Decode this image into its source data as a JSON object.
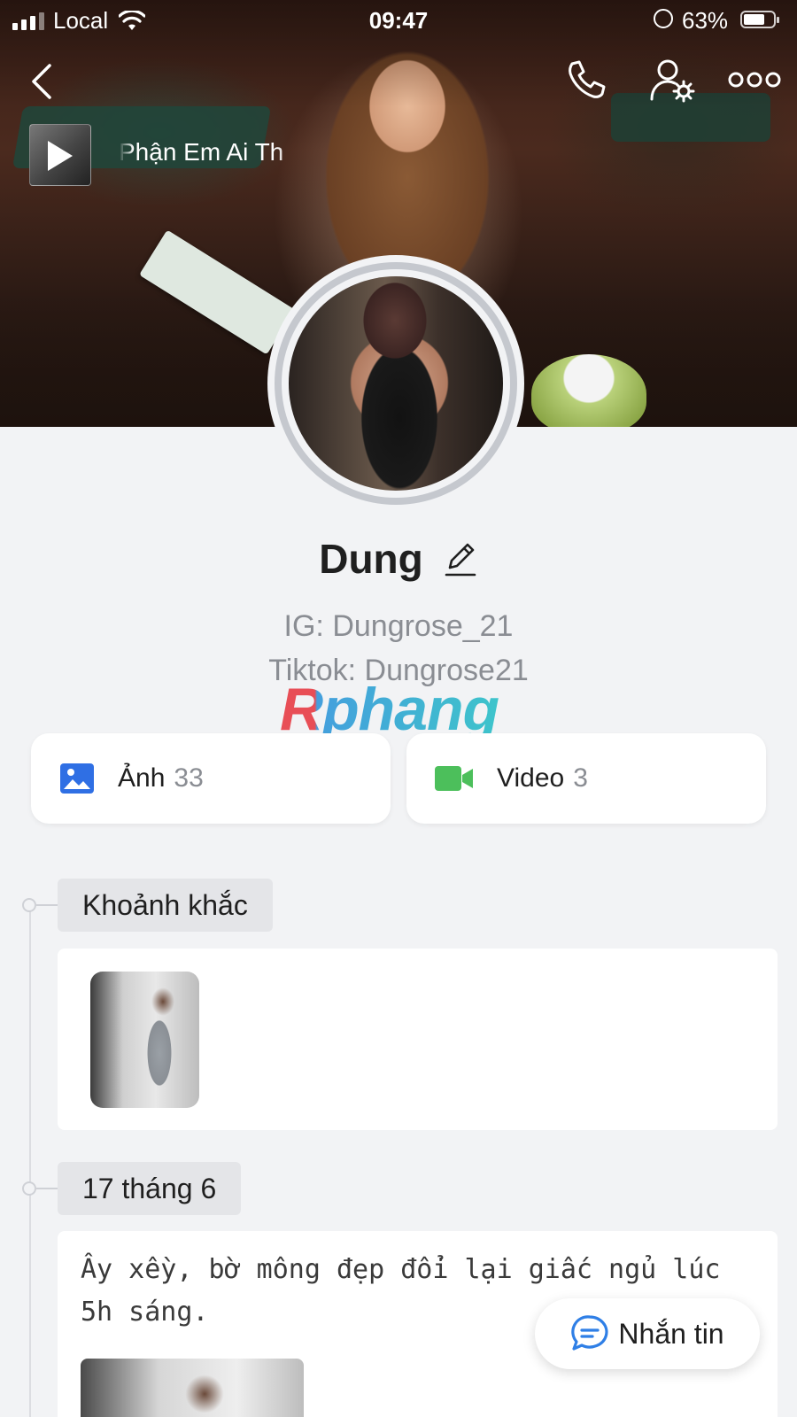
{
  "status_bar": {
    "carrier": "Local",
    "time": "09:47",
    "battery": "63%"
  },
  "cover": {
    "music_title": "Phận Em Ai Th"
  },
  "profile": {
    "name": "Dung",
    "bio_line_1": "IG: Dungrose_21",
    "bio_line_2": "Tiktok: Dungrose21"
  },
  "watermark": "Rphang",
  "media": {
    "photos_label": "Ảnh",
    "photos_count": "33",
    "videos_label": "Video",
    "videos_count": "3"
  },
  "timeline": {
    "moments_label": "Khoảnh khắc",
    "date_label": "17 tháng 6",
    "post_text": "Ây xềy, bờ mông đẹp đổi lại giấc ngủ lúc 5h sáng."
  },
  "fab": {
    "label": "Nhắn tin"
  },
  "colors": {
    "background": "#f2f3f5",
    "photo_icon": "#2f6fe4",
    "video_icon": "#4cbf5b",
    "chat_icon": "#2f7fe6"
  },
  "icons": [
    "back-icon",
    "phone-icon",
    "user-settings-icon",
    "more-icon",
    "play-icon",
    "edit-icon",
    "photo-icon",
    "video-icon",
    "chat-icon"
  ]
}
